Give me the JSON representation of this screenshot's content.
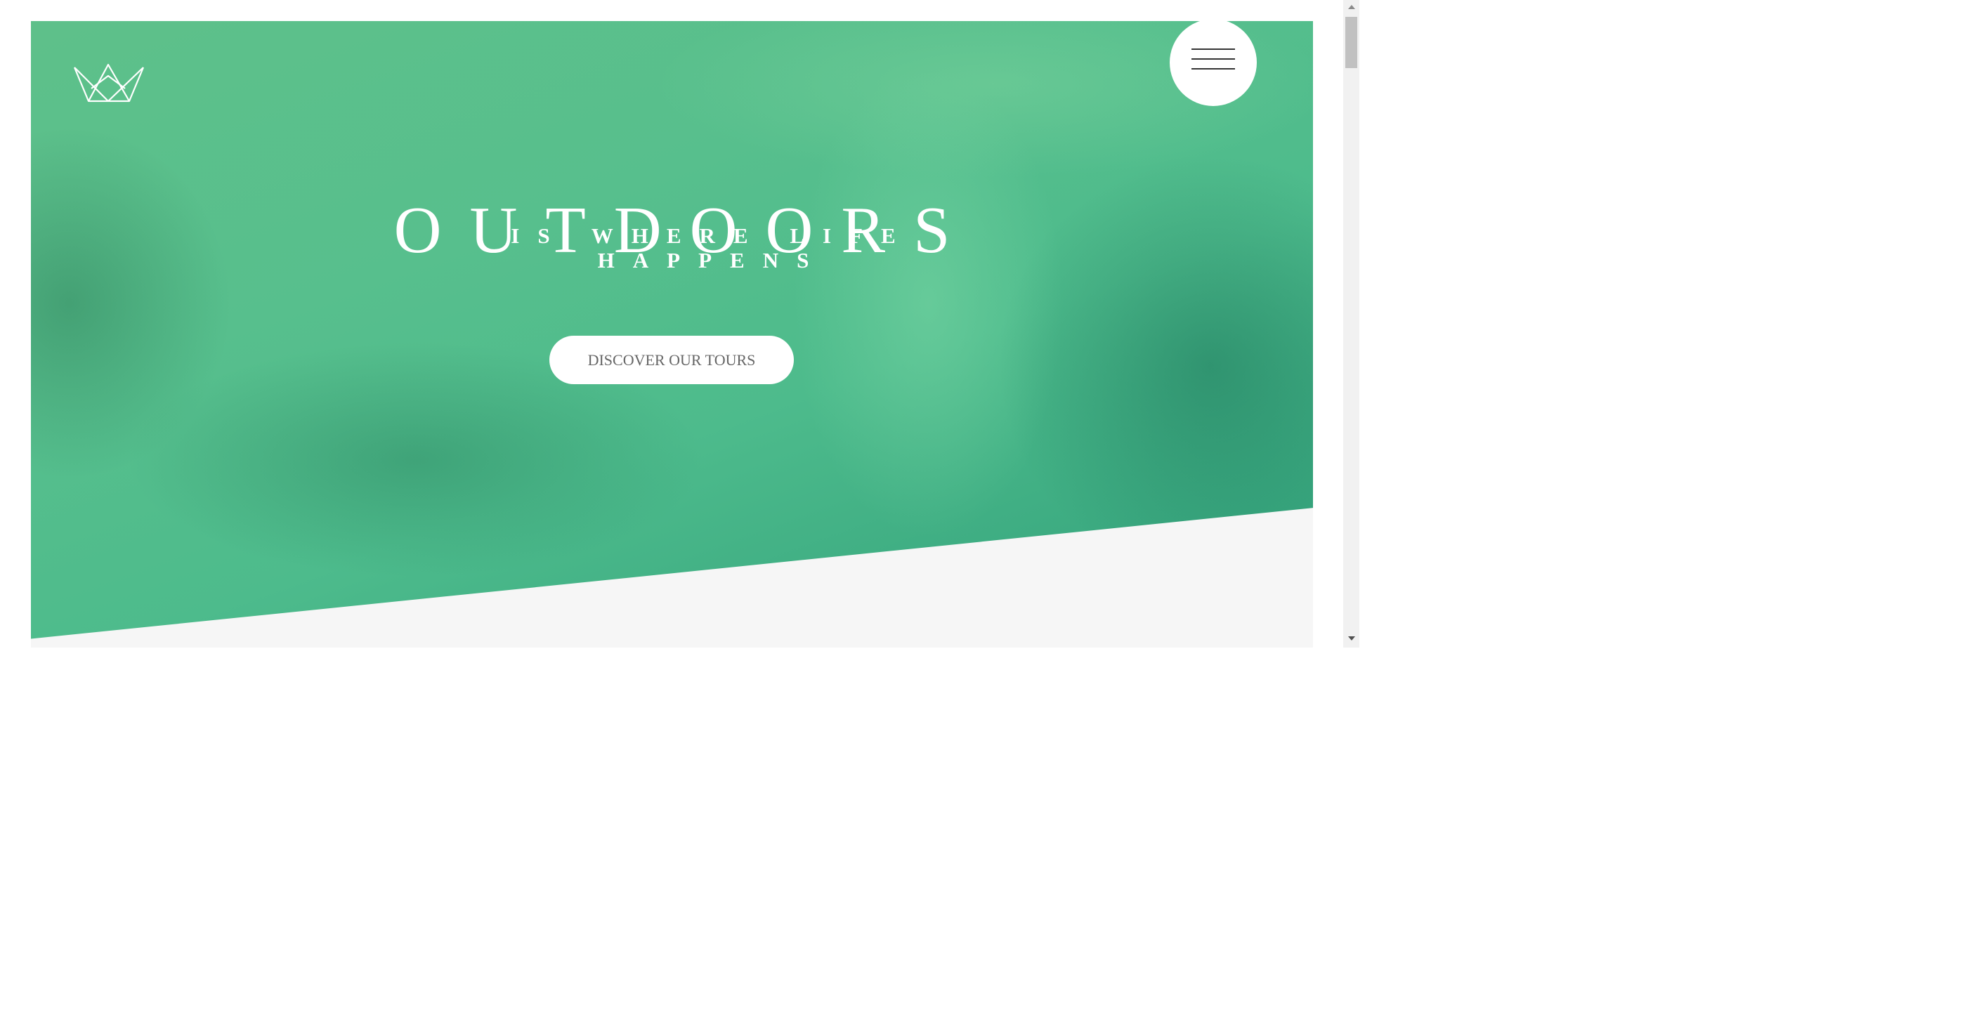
{
  "logo": {
    "icon": "crown-icon"
  },
  "menu": {
    "icon": "hamburger-menu-icon"
  },
  "hero": {
    "title": "OUTDOORS",
    "subtitle": "IS WHERE LIFE HAPPENS",
    "cta_label": "DISCOVER OUR TOURS"
  },
  "colors": {
    "hero_green": "#55bd8a",
    "section_background": "#f6f6f6",
    "button_background": "#ffffff",
    "button_text": "#666666",
    "menu_lines": "#333333"
  },
  "scrollbar": {
    "up_icon": "scroll-up-arrow-icon",
    "down_icon": "scroll-down-arrow-icon"
  }
}
